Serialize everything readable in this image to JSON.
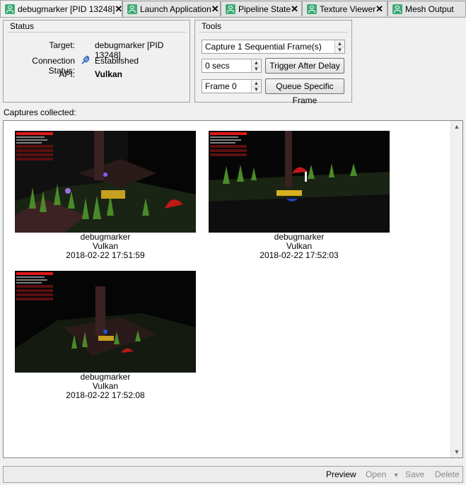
{
  "tabs": [
    {
      "label": "debugmarker [PID 13248]",
      "active": true
    },
    {
      "label": "Launch Application",
      "active": false
    },
    {
      "label": "Pipeline State",
      "active": false
    },
    {
      "label": "Texture Viewer",
      "active": false
    },
    {
      "label": "Mesh Output",
      "active": false
    }
  ],
  "tab_close_glyph": "✕",
  "status": {
    "title": "Status",
    "target_label": "Target:",
    "target_value": "debugmarker [PID 13248]",
    "connection_label": "Connection Status:",
    "connection_value": "Established",
    "connection_icon": "connected-icon",
    "api_label": "API:",
    "api_value": "Vulkan"
  },
  "tools": {
    "title": "Tools",
    "capture_mode": "Capture 1 Sequential Frame(s)",
    "delay_value": "0 secs",
    "trigger_button": "Trigger After Delay",
    "frame_value": "Frame 0",
    "queue_button": "Queue Specific Frame"
  },
  "captures": {
    "label": "Captures collected:",
    "items": [
      {
        "name": "debugmarker",
        "api": "Vulkan",
        "timestamp": "2018-02-22 17:51:59"
      },
      {
        "name": "debugmarker",
        "api": "Vulkan",
        "timestamp": "2018-02-22 17:52:03"
      },
      {
        "name": "debugmarker",
        "api": "Vulkan",
        "timestamp": "2018-02-22 17:52:08"
      }
    ]
  },
  "actions": {
    "preview": "Preview",
    "open": "Open",
    "save": "Save",
    "delete": "Delete"
  },
  "colors": {
    "tab_icon": "#3faa77",
    "overlay_red": "#e01818",
    "grass": "#4a8a2a",
    "trunk": "#5a3028"
  }
}
